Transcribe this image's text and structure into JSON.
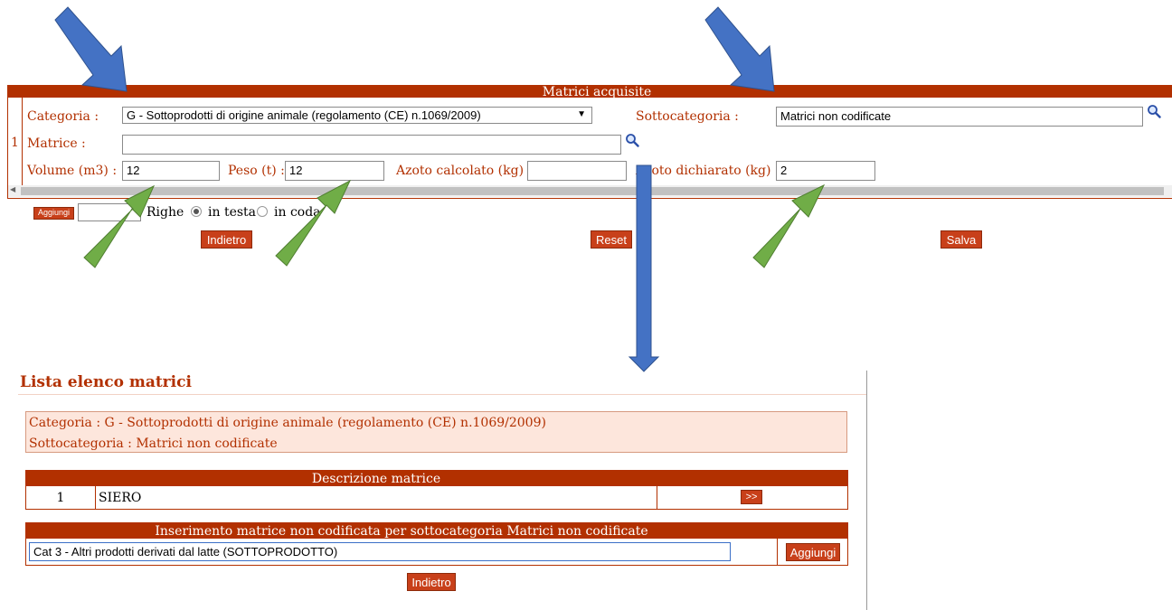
{
  "top_panel": {
    "header": "Matrici acquisite",
    "row_number": "1",
    "categoria_label": "Categoria :",
    "categoria_value": "G - Sottoprodotti di origine animale (regolamento (CE) n.1069/2009)",
    "sottocategoria_label": "Sottocategoria :",
    "sottocategoria_value": "Matrici non codificate",
    "matrice_label": "Matrice :",
    "matrice_value": "",
    "volume_label": "Volume (m3) :",
    "volume_value": "12",
    "peso_label": "Peso (t) :",
    "peso_value": "12",
    "azoto_calcolato_label": "Azoto calcolato (kg) :",
    "azoto_calcolato_value": "",
    "azoto_dichiarato_label": "Azoto dichiarato (kg) :",
    "azoto_dichiarato_value": "2"
  },
  "add_row": {
    "button": "Aggiungi",
    "count_value": "",
    "righe_label": "Righe",
    "radio_testa": "in testa",
    "radio_coda": "in coda"
  },
  "actions": {
    "indietro": "Indietro",
    "reset": "Reset",
    "salva": "Salva"
  },
  "lista": {
    "title": "Lista elenco matrici",
    "info_categoria": "Categoria : G - Sottoprodotti di origine animale (regolamento (CE) n.1069/2009)",
    "info_sottocategoria": "Sottocategoria : Matrici non codificate",
    "table_header": "Descrizione matrice",
    "rows": [
      {
        "num": "1",
        "desc": "SIERO",
        "action": ">>"
      }
    ],
    "insert_header": "Inserimento matrice non codificata per sottocategoria  Matrici non codificate",
    "insert_value": "Cat 3 - Altri prodotti derivati dal latte (SOTTOPRODOTTO)",
    "insert_button": "Aggiungi",
    "back_button": "Indietro"
  },
  "colors": {
    "brand": "#b23000",
    "panel_bg": "#fde6dc",
    "arrow_blue": "#4472c4",
    "arrow_green": "#70ad47"
  }
}
